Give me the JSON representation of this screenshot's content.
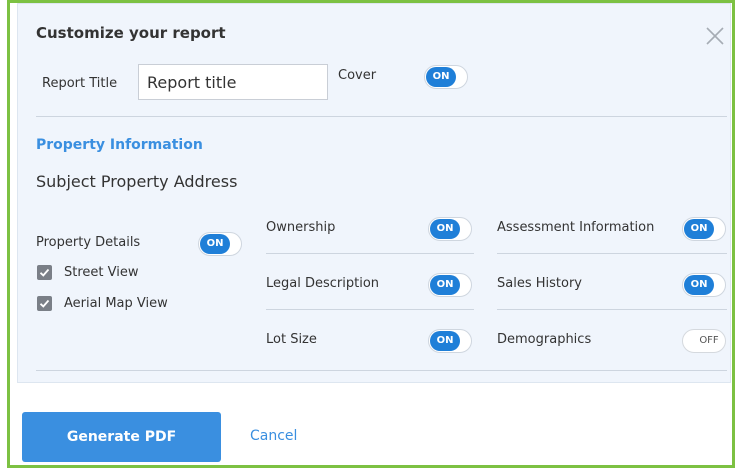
{
  "dialog": {
    "title": "Customize your report",
    "close_icon": "close-icon"
  },
  "report_title": {
    "label": "Report Title",
    "value": "Report title",
    "placeholder": "Report title"
  },
  "cover": {
    "label": "Cover",
    "toggle": "ON"
  },
  "property_information": {
    "heading": "Property Information",
    "subject_address": "Subject Property Address",
    "property_details": {
      "label": "Property Details",
      "toggle": "ON",
      "checkboxes": [
        {
          "label": "Street View",
          "checked": true
        },
        {
          "label": "Aerial Map View",
          "checked": true
        }
      ]
    },
    "options": [
      {
        "label": "Ownership",
        "toggle": "ON"
      },
      {
        "label": "Assessment Information",
        "toggle": "ON"
      },
      {
        "label": "Legal Description",
        "toggle": "ON"
      },
      {
        "label": "Sales History",
        "toggle": "ON"
      },
      {
        "label": "Lot Size",
        "toggle": "ON"
      },
      {
        "label": "Demographics",
        "toggle": "OFF"
      }
    ]
  },
  "actions": {
    "generate_label": "Generate PDF",
    "cancel_label": "Cancel"
  },
  "colors": {
    "accent": "#3a8fe0",
    "toggle_on": "#1f7fd8",
    "frame_border": "#7cc142",
    "panel_bg": "#f0f5fc"
  }
}
